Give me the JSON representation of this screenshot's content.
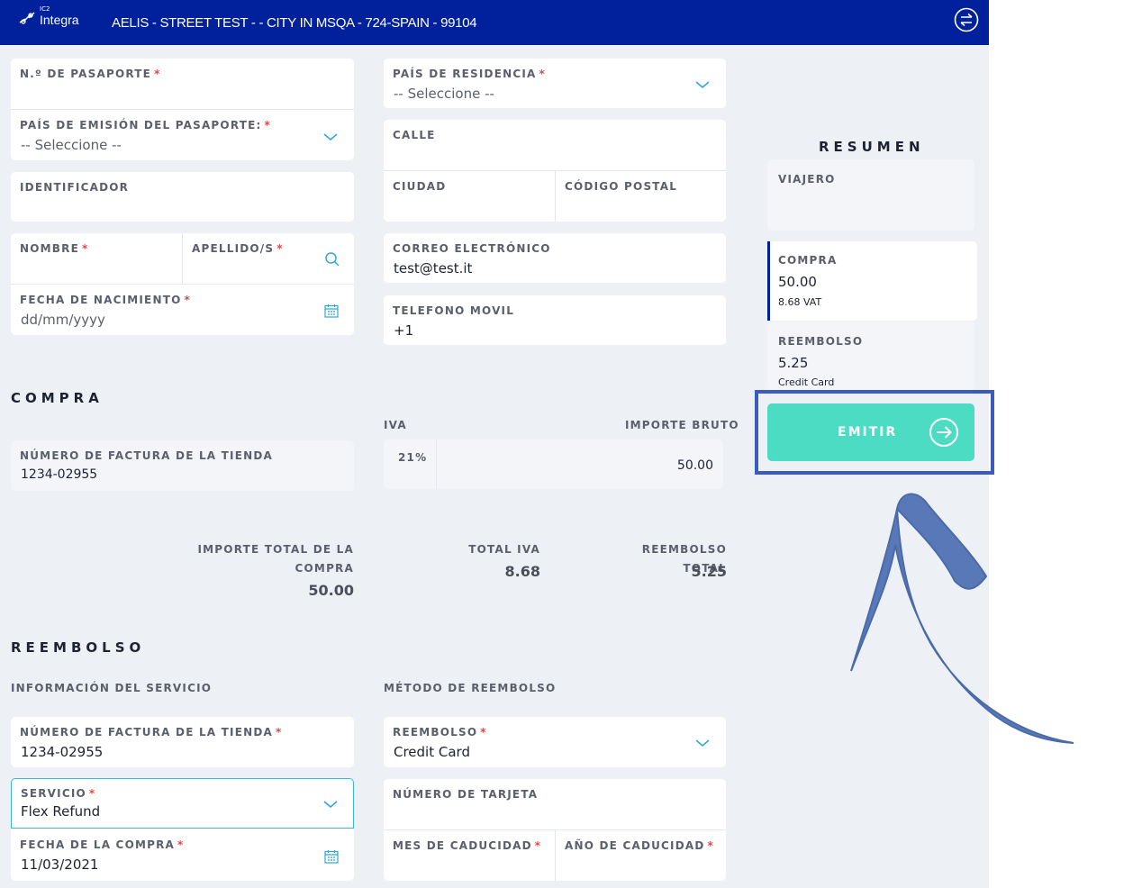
{
  "header": {
    "logo_small": "IC2",
    "logo_name": "Integra",
    "title": "AELIS - STREET TEST - - CITY IN MSQA - 724-SPAIN - 99104"
  },
  "traveler": {
    "passport_label": "N.º DE PASAPORTE",
    "passport_value": "",
    "issuing_country_label": "PAÍS DE EMISIÓN DEL PASAPORTE:",
    "issuing_country_value": "-- Seleccione --",
    "identifier_label": "IDENTIFICADOR",
    "identifier_value": "",
    "name_label": "NOMBRE",
    "surname_label": "APELLIDO/S",
    "birthdate_label": "FECHA DE NACIMIENTO",
    "birthdate_placeholder": "dd/mm/yyyy",
    "residence_label": "PAÍS DE RESIDENCIA",
    "residence_value": "-- Seleccione --",
    "street_label": "CALLE",
    "city_label": "CIUDAD",
    "postal_label": "CÓDIGO POSTAL",
    "email_label": "CORREO ELECTRÓNICO",
    "email_value": "test@test.it",
    "phone_label": "TELEFONO MOVIL",
    "phone_value": "+1"
  },
  "compra": {
    "title": "COMPRA",
    "invoice_label": "NÚMERO DE FACTURA DE LA TIENDA",
    "invoice_value": "1234-02955",
    "iva_header": "IVA",
    "gross_header": "IMPORTE BRUTO",
    "iva_rate": "21%",
    "gross_value": "50.00",
    "total_purchase_label_1": "IMPORTE TOTAL DE LA",
    "total_purchase_label_2": "COMPRA",
    "total_purchase_value": "50.00",
    "total_iva_label": "TOTAL IVA",
    "total_iva_value": "8.68",
    "total_refund_label": "REEMBOLSO TOTAL",
    "total_refund_value": "5.25"
  },
  "reembolso": {
    "title": "REEMBOLSO",
    "service_info_title": "INFORMACIÓN DEL SERVICIO",
    "method_title": "MÉTODO DE REEMBOLSO",
    "invoice_label": "NÚMERO DE FACTURA DE LA TIENDA",
    "invoice_value": "1234-02955",
    "service_label": "SERVICIO",
    "service_value": "Flex Refund",
    "purchase_date_label": "FECHA DE LA COMPRA",
    "purchase_date_value": "11/03/2021",
    "method_label": "REEMBOLSO",
    "method_value": "Credit Card",
    "card_number_label": "NÚMERO DE TARJETA",
    "exp_month_label": "MES DE CADUCIDAD",
    "exp_year_label": "AÑO DE CADUCIDAD"
  },
  "summary": {
    "title": "RESUMEN",
    "traveler_label": "VIAJERO",
    "purchase_label": "COMPRA",
    "purchase_value": "50.00",
    "purchase_vat": "8.68 VAT",
    "refund_label": "REEMBOLSO",
    "refund_value": "5.25",
    "refund_method": "Credit Card",
    "emit_label": "EMITIR"
  },
  "colors": {
    "topbar": "#00209c",
    "emit_button": "#4cdbc3",
    "highlight": "#3b5bbf",
    "arrow": "#5878b8",
    "required": "#e04848",
    "accent_icon": "#2fa6d6"
  },
  "icons": [
    "logo-icon",
    "swap-icon",
    "chevron-down-icon",
    "search-icon",
    "calendar-icon",
    "arrow-right-circle-icon",
    "curved-arrow-annotation"
  ]
}
